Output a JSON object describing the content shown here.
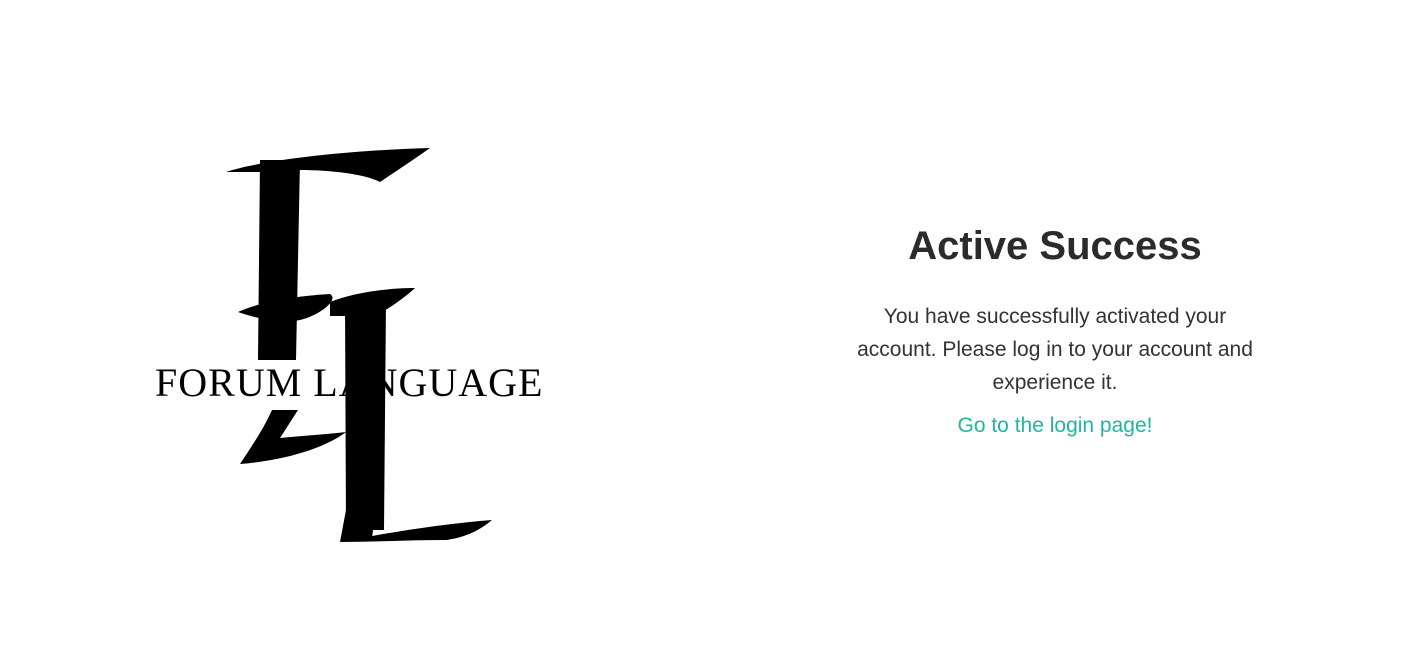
{
  "logo": {
    "wordmark": "FORUM LANGUAGE",
    "monogram": "FL",
    "color": "#000000"
  },
  "activation": {
    "title": "Active Success",
    "message": "You have successfully activated your account. Please log in to your account and experience it.",
    "login_link_label": "Go to the login page!"
  },
  "colors": {
    "background": "#ffffff",
    "text": "#333333",
    "link": "#1fb5a2"
  }
}
